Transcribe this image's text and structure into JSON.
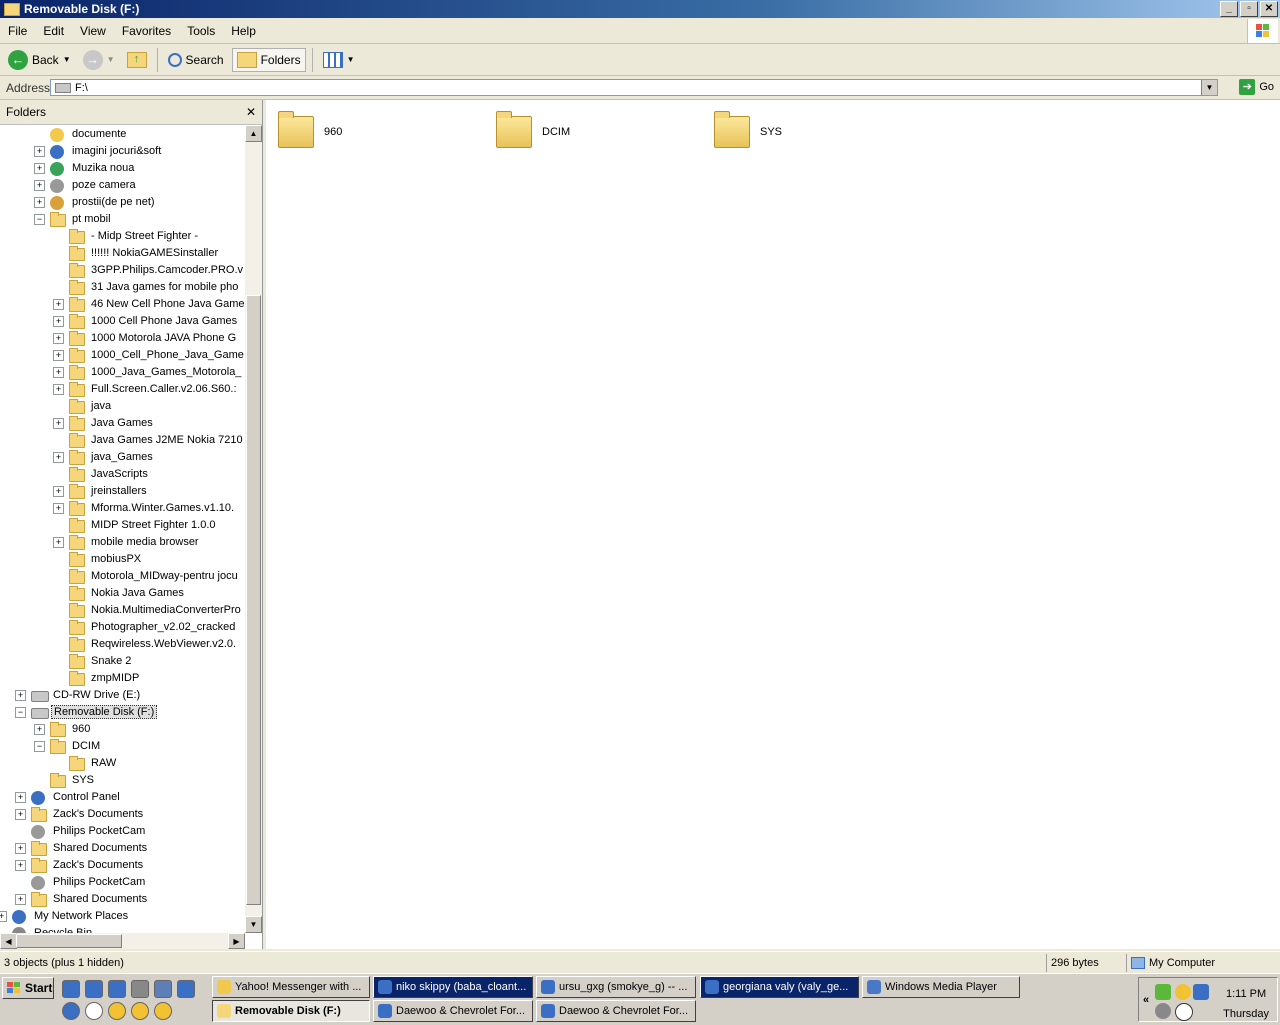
{
  "window": {
    "title": "Removable Disk (F:)"
  },
  "menu": [
    "File",
    "Edit",
    "View",
    "Favorites",
    "Tools",
    "Help"
  ],
  "toolbar": {
    "back": "Back",
    "search": "Search",
    "folders": "Folders"
  },
  "address": {
    "label": "Address",
    "value": "F:\\",
    "go": "Go"
  },
  "folders_pane": {
    "title": "Folders",
    "items": [
      {
        "label": "documente",
        "depth": 2,
        "exp": "",
        "icon": "special-icon",
        "color": "#f2c94c"
      },
      {
        "label": "imagini jocuri&soft",
        "depth": 2,
        "exp": "+",
        "icon": "app-icon",
        "color": "#3b6fc4"
      },
      {
        "label": "Muzika noua",
        "depth": 2,
        "exp": "+",
        "icon": "music-icon",
        "color": "#3aa35a"
      },
      {
        "label": "poze camera",
        "depth": 2,
        "exp": "+",
        "icon": "camera-icon",
        "color": "#999999"
      },
      {
        "label": "prostii(de pe net)",
        "depth": 2,
        "exp": "+",
        "icon": "bag-icon",
        "color": "#d9a13b"
      },
      {
        "label": "pt mobil",
        "depth": 2,
        "exp": "-",
        "icon": "folder-icon"
      },
      {
        "label": "- Midp Street Fighter -",
        "depth": 3,
        "exp": "",
        "icon": "folder-icon"
      },
      {
        "label": "!!!!!! NokiaGAMESinstaller",
        "depth": 3,
        "exp": "",
        "icon": "folder-icon"
      },
      {
        "label": "3GPP.Philips.Camcoder.PRO.v",
        "depth": 3,
        "exp": "",
        "icon": "folder-icon"
      },
      {
        "label": "31 Java games for mobile pho",
        "depth": 3,
        "exp": "",
        "icon": "folder-icon"
      },
      {
        "label": "46 New Cell Phone Java Game",
        "depth": 3,
        "exp": "+",
        "icon": "folder-icon"
      },
      {
        "label": "1000 Cell Phone Java Games",
        "depth": 3,
        "exp": "+",
        "icon": "folder-icon"
      },
      {
        "label": "1000 Motorola  JAVA Phone G",
        "depth": 3,
        "exp": "+",
        "icon": "folder-icon"
      },
      {
        "label": "1000_Cell_Phone_Java_Game",
        "depth": 3,
        "exp": "+",
        "icon": "folder-icon"
      },
      {
        "label": "1000_Java_Games_Motorola_",
        "depth": 3,
        "exp": "+",
        "icon": "folder-icon"
      },
      {
        "label": "Full.Screen.Caller.v2.06.S60.:",
        "depth": 3,
        "exp": "+",
        "icon": "folder-icon"
      },
      {
        "label": "java",
        "depth": 3,
        "exp": "",
        "icon": "folder-icon"
      },
      {
        "label": "Java Games",
        "depth": 3,
        "exp": "+",
        "icon": "folder-icon"
      },
      {
        "label": "Java Games J2ME Nokia 7210",
        "depth": 3,
        "exp": "",
        "icon": "folder-icon"
      },
      {
        "label": "java_Games",
        "depth": 3,
        "exp": "+",
        "icon": "folder-icon"
      },
      {
        "label": "JavaScripts",
        "depth": 3,
        "exp": "",
        "icon": "folder-icon"
      },
      {
        "label": "jreinstallers",
        "depth": 3,
        "exp": "+",
        "icon": "folder-icon"
      },
      {
        "label": "Mforma.Winter.Games.v1.10.",
        "depth": 3,
        "exp": "+",
        "icon": "folder-icon"
      },
      {
        "label": "MIDP Street Fighter 1.0.0",
        "depth": 3,
        "exp": "",
        "icon": "folder-icon"
      },
      {
        "label": "mobile media browser",
        "depth": 3,
        "exp": "+",
        "icon": "folder-icon"
      },
      {
        "label": "mobiusPX",
        "depth": 3,
        "exp": "",
        "icon": "folder-icon"
      },
      {
        "label": "Motorola_MIDway-pentru jocu",
        "depth": 3,
        "exp": "",
        "icon": "folder-icon"
      },
      {
        "label": "Nokia Java Games",
        "depth": 3,
        "exp": "",
        "icon": "folder-icon"
      },
      {
        "label": "Nokia.MultimediaConverterPro",
        "depth": 3,
        "exp": "",
        "icon": "folder-icon"
      },
      {
        "label": "Photographer_v2.02_cracked",
        "depth": 3,
        "exp": "",
        "icon": "folder-icon"
      },
      {
        "label": "Reqwireless.WebViewer.v2.0.",
        "depth": 3,
        "exp": "",
        "icon": "folder-icon"
      },
      {
        "label": "Snake 2",
        "depth": 3,
        "exp": "",
        "icon": "folder-icon"
      },
      {
        "label": "zmpMIDP",
        "depth": 3,
        "exp": "",
        "icon": "folder-icon"
      },
      {
        "label": "CD-RW Drive (E:)",
        "depth": 1,
        "exp": "+",
        "icon": "cd-drive-icon"
      },
      {
        "label": "Removable Disk (F:)",
        "depth": 1,
        "exp": "-",
        "icon": "removable-disk-icon",
        "selected": true
      },
      {
        "label": "960",
        "depth": 2,
        "exp": "+",
        "icon": "folder-icon"
      },
      {
        "label": "DCIM",
        "depth": 2,
        "exp": "-",
        "icon": "folder-icon"
      },
      {
        "label": "RAW",
        "depth": 3,
        "exp": "",
        "icon": "folder-icon"
      },
      {
        "label": "SYS",
        "depth": 2,
        "exp": "",
        "icon": "folder-icon"
      },
      {
        "label": "Control Panel",
        "depth": 1,
        "exp": "+",
        "icon": "control-panel-icon",
        "color": "#3b6fc4"
      },
      {
        "label": "Zack's Documents",
        "depth": 1,
        "exp": "+",
        "icon": "folder-icon"
      },
      {
        "label": "Philips PocketCam",
        "depth": 1,
        "exp": "",
        "icon": "camera-icon",
        "color": "#999999"
      },
      {
        "label": "Shared Documents",
        "depth": 1,
        "exp": "+",
        "icon": "folder-icon"
      },
      {
        "label": "Zack's Documents",
        "depth": 1,
        "exp": "+",
        "icon": "folder-icon"
      },
      {
        "label": "Philips PocketCam",
        "depth": 1,
        "exp": "",
        "icon": "camera-icon",
        "color": "#999999"
      },
      {
        "label": "Shared Documents",
        "depth": 1,
        "exp": "+",
        "icon": "folder-icon"
      },
      {
        "label": "My Network Places",
        "depth": 0,
        "exp": "+",
        "icon": "network-icon",
        "color": "#3b6fc4"
      },
      {
        "label": "Recycle Bin",
        "depth": 0,
        "exp": "",
        "icon": "recycle-bin-icon",
        "color": "#888888"
      }
    ]
  },
  "content": {
    "folders": [
      "960",
      "DCIM",
      "SYS"
    ]
  },
  "status": {
    "objects": "3 objects (plus 1 hidden)",
    "size": "296 bytes",
    "location": "My Computer"
  },
  "taskbar": {
    "start": "Start",
    "tasks_row1": [
      {
        "label": "Yahoo! Messenger with ...",
        "style": "normal",
        "color": "#f2c94c"
      },
      {
        "label": "niko skippy (baba_cloant...",
        "style": "flash",
        "color": "#3b6fc4"
      },
      {
        "label": "ursu_gxg (smokye_g) -- ...",
        "style": "normal",
        "color": "#3b6fc4"
      },
      {
        "label": "georgiana valy (valy_ge...",
        "style": "flash",
        "color": "#3b6fc4"
      },
      {
        "label": "Windows Media Player",
        "style": "normal",
        "color": "#4a78c9"
      }
    ],
    "tasks_row2": [
      {
        "label": "Removable Disk (F:)",
        "style": "pressed",
        "color": "#f5d67b"
      },
      {
        "label": "Daewoo & Chevrolet For...",
        "style": "normal",
        "color": "#3b6fc4"
      },
      {
        "label": "Daewoo & Chevrolet For...",
        "style": "normal",
        "color": "#3b6fc4"
      }
    ],
    "clock": {
      "time": "1:11 PM",
      "day": "Thursday"
    }
  }
}
